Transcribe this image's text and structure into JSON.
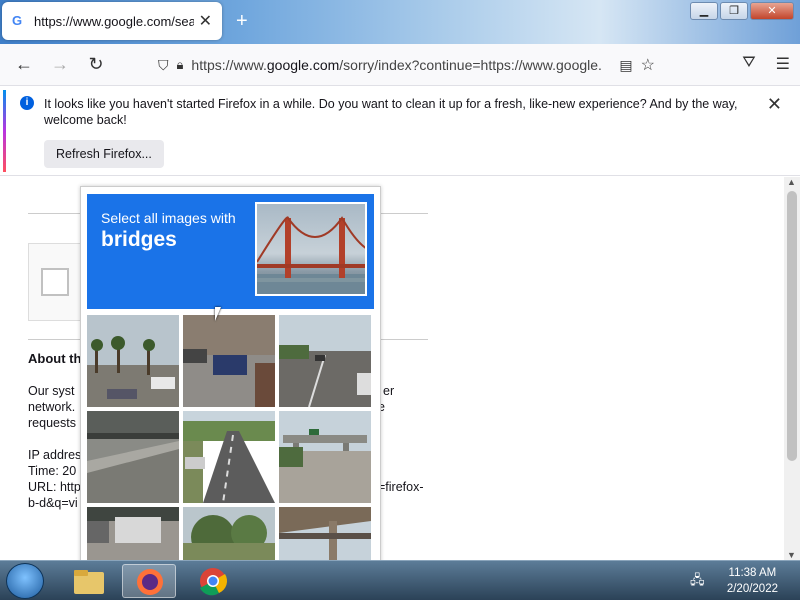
{
  "browser": {
    "tab": {
      "title": "https://www.google.com/search?",
      "favicon": "google-g-icon"
    },
    "url": {
      "full": "https://www.google.com/sorry/index?continue=https://www.google.",
      "prefix": "https://www.",
      "domain": "google.com",
      "rest": "/sorry/index?continue=https://www.google."
    },
    "notification": {
      "message": "It looks like you haven't started Firefox in a while. Do you want to clean it up for a fresh, like-new experience? And by the way, welcome back!",
      "button_label": "Refresh Firefox..."
    }
  },
  "page": {
    "about_heading": "About th",
    "para_lines": [
      "Our syst",
      "network.",
      "requests"
    ],
    "right_frags": [
      "er",
      "e"
    ],
    "ip_line": "IP addres",
    "time_line": "Time: 20",
    "url_line": "URL: http",
    "url_tail": "=firefox-",
    "url_line2": "b-d&q=vi"
  },
  "captcha": {
    "instruction": "Select all images with",
    "target": "bridges",
    "colors": {
      "header": "#1a73e8"
    }
  },
  "taskbar": {
    "time": "11:38 AM",
    "date": "2/20/2022"
  }
}
